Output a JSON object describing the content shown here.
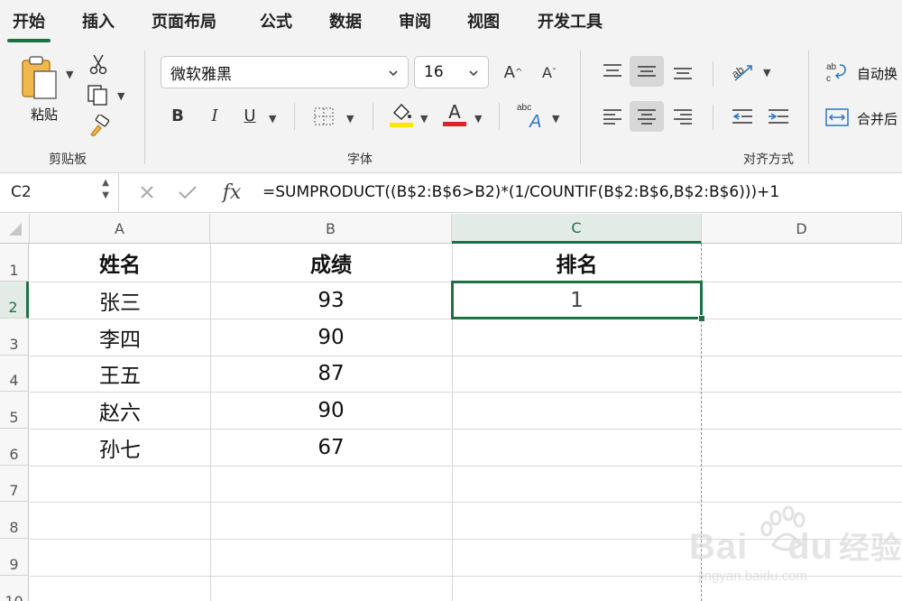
{
  "menu": {
    "tabs": [
      "开始",
      "插入",
      "页面布局",
      "公式",
      "数据",
      "审阅",
      "视图",
      "开发工具"
    ],
    "active": "开始"
  },
  "ribbon": {
    "clipboard": {
      "paste_label": "粘贴",
      "group_label": "剪贴板"
    },
    "font": {
      "font_name": "微软雅黑",
      "font_size": "16",
      "group_label": "字体",
      "bold": "B",
      "italic": "I",
      "underline": "U",
      "font_color_letter": "A",
      "fill_color": "#ffe600",
      "font_color": "#e0202a"
    },
    "alignment": {
      "group_label": "对齐方式",
      "wrap_text": "自动换",
      "merge": "合并后"
    }
  },
  "formula_bar": {
    "name_box": "C2",
    "fx": "fx",
    "formula": "=SUMPRODUCT((B$2:B$6>B2)*(1/COUNTIF(B$2:B$6,B$2:B$6)))+1"
  },
  "sheet": {
    "columns": [
      "A",
      "B",
      "C",
      "D"
    ],
    "rows": [
      "1",
      "2",
      "3",
      "4",
      "5",
      "6",
      "7",
      "8",
      "9",
      "10"
    ],
    "selected_cell": "C2",
    "headers": {
      "name": "姓名",
      "score": "成绩",
      "rank": "排名"
    },
    "records": [
      {
        "name": "张三",
        "score": "93"
      },
      {
        "name": "李四",
        "score": "90"
      },
      {
        "name": "王五",
        "score": "87"
      },
      {
        "name": "赵六",
        "score": "90"
      },
      {
        "name": "孙七",
        "score": "67"
      }
    ],
    "c2_value": "1"
  },
  "watermark": {
    "brand": "Bai",
    "brand2": "du",
    "label": "经验",
    "url": "jingyan.baidu.com"
  }
}
